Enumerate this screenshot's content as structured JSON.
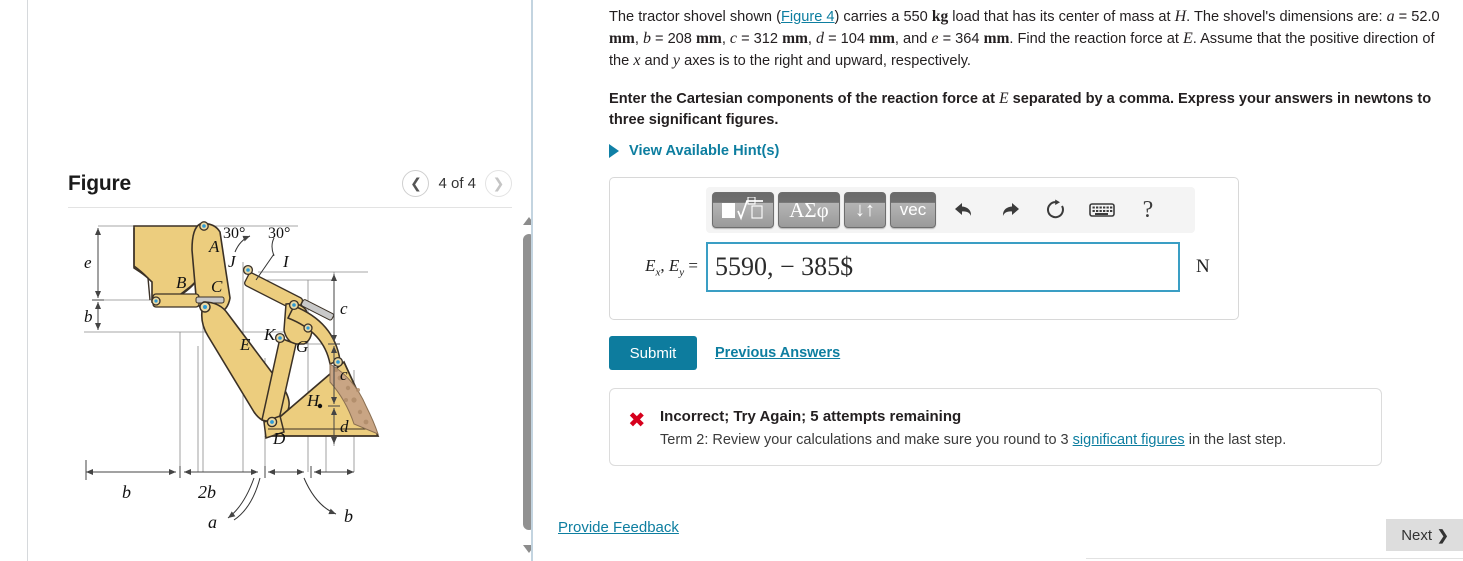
{
  "figure_panel": {
    "title": "Figure",
    "pager": {
      "prev_icon": "chevron-left-icon",
      "next_icon": "chevron-right-icon",
      "label": "4 of 4"
    },
    "scrollbar": {
      "up_icon": "triangle-up-icon",
      "down_icon": "triangle-down-icon"
    },
    "diagram": {
      "caption_points": [
        "A",
        "B",
        "C",
        "D",
        "E",
        "G",
        "H",
        "I",
        "J",
        "K"
      ],
      "angle_labels": [
        "30°",
        "30°"
      ],
      "dimension_labels": [
        "e",
        "b",
        "b",
        "2b",
        "a",
        "b",
        "c",
        "c",
        "d"
      ],
      "fill_color": "#eccd7e",
      "outline_color": "#3b3126",
      "pin_color": "#2e9bd6",
      "soil_color": "#c9a584"
    }
  },
  "problem": {
    "body_part1": "The tractor shovel shown (",
    "figure_link": "Figure 4",
    "body_part2": ") carries a 550 ",
    "unit_kg": "kg",
    "body_part3": " load that has its center of mass at ",
    "sym_H": "H",
    "body_part4": ". The shovel's dimensions",
    "line2_pre": "are: ",
    "sym_a": "a",
    "val_a": " = 52.0 ",
    "unit_mm1": "mm",
    "sep1": ", ",
    "sym_b": "b",
    "val_b": " = 208 ",
    "unit_mm2": "mm",
    "sep2": ", ",
    "sym_c": "c",
    "val_c": " = 312 ",
    "unit_mm3": "mm",
    "sep3": ", ",
    "sym_d": "d",
    "val_d": " = 104 ",
    "unit_mm4": "mm",
    "sep4": ", and ",
    "sym_e": "e",
    "val_e": " = 364 ",
    "unit_mm5": "mm",
    "tail1": ". Find the reaction force at ",
    "sym_E": "E",
    "tail2": ". Assume",
    "line3_pre": "that the positive direction of the ",
    "sym_x": "x",
    "line3_mid": " and ",
    "sym_y": "y",
    "line3_tail": " axes is to the right and upward, respectively."
  },
  "instruction": {
    "part1": "Enter the Cartesian components of the reaction force at ",
    "sym_E": "E",
    "part2": " separated by a comma. Express your answers  in",
    "line2": "newtons to three significant figures."
  },
  "hints": {
    "label": "View Available Hint(s)",
    "triangle_icon": "triangle-right-icon"
  },
  "answer_area": {
    "toolbar": {
      "sqrt_button": "√",
      "greek_button": "ΑΣφ",
      "updown_button": "↓↑",
      "vec_button": "vec",
      "undo_icon": "undo-arrow-icon",
      "redo_icon": "redo-arrow-icon",
      "reset_icon": "refresh-circular-arrow-icon",
      "keyboard_icon": "keyboard-icon",
      "help_button": "?"
    },
    "label_Ex": "E",
    "label_Ex_sub": "x",
    "label_comma": ", ",
    "label_Ey": "E",
    "label_Ey_sub": "y",
    "label_eq": " =",
    "value": "5590, − 385$",
    "unit": "N"
  },
  "actions": {
    "submit_label": "Submit",
    "previous_answers_label": "Previous Answers"
  },
  "feedback": {
    "status_icon": "red-x-icon",
    "status_color": "#d6001c",
    "title": "Incorrect; Try Again; 5 attempts remaining",
    "detail_pre": "Term 2: Review your calculations and make sure you round to 3 ",
    "detail_link": "significant figures",
    "detail_post": " in the last step."
  },
  "footer": {
    "provide_feedback_label": "Provide Feedback",
    "next_label": "Next",
    "next_icon": "chevron-right-icon"
  },
  "theme": {
    "accent": "#0d7ea0",
    "submit_bg": "#0d7c9e",
    "input_border": "#3a9ec4",
    "error": "#d6001c"
  }
}
